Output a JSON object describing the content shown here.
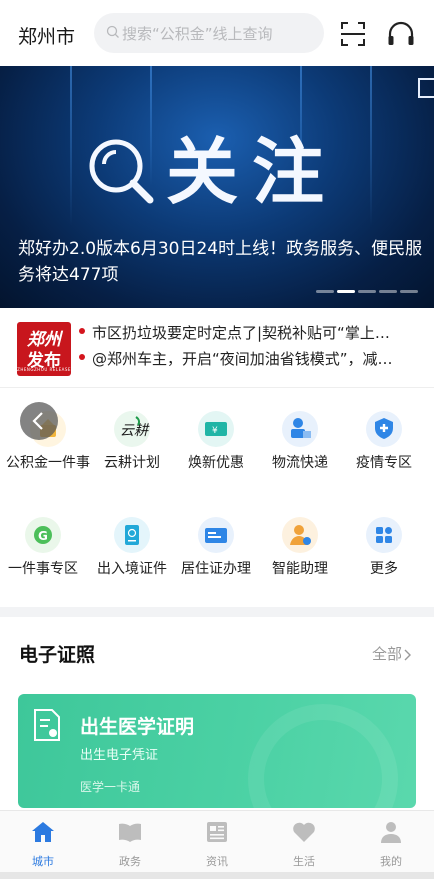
{
  "header": {
    "city": "郑州市",
    "search_placeholder": "搜索“公积金”线上查询"
  },
  "banner": {
    "headline": "关注",
    "caption": "郑好办2.0版本6月30日24时上线！政务服务、便民服务将达477项",
    "dots": 5,
    "active_dot": 1
  },
  "news": {
    "logo_line1": "郑州",
    "logo_line2": "发布",
    "logo_line3": "ZHENGZHOU RELEASE",
    "items": [
      "市区扔垃圾要定时定点了|契税补贴可“掌上…",
      "@郑州车主，开启“夜间加油省钱模式”，减…"
    ]
  },
  "services": [
    {
      "label": "公积金一件事",
      "icon": "housing-fund-icon",
      "color": "#f2b53a"
    },
    {
      "label": "云耕计划",
      "icon": "yungeng-icon",
      "color": "#1e9a4a"
    },
    {
      "label": "焕新优惠",
      "icon": "voucher-icon",
      "color": "#20b5a6"
    },
    {
      "label": "物流快递",
      "icon": "courier-icon",
      "color": "#2f86e6"
    },
    {
      "label": "疫情专区",
      "icon": "medical-shield-icon",
      "color": "#2f86e6"
    },
    {
      "label": "一件事专区",
      "icon": "one-thing-icon",
      "color": "#4cbf5a"
    },
    {
      "label": "出入境证件",
      "icon": "passport-icon",
      "color": "#22a8d8"
    },
    {
      "label": "居住证办理",
      "icon": "residence-card-icon",
      "color": "#2f86e6"
    },
    {
      "label": "智能助理",
      "icon": "assistant-icon",
      "color": "#f0a23a"
    },
    {
      "label": "更多",
      "icon": "more-grid-icon",
      "color": "#2f86e6"
    }
  ],
  "certificates": {
    "title": "电子证照",
    "all_label": "全部",
    "card": {
      "title": "出生医学证明",
      "subtitle": "出生电子凭证",
      "source": "医学一卡通",
      "color": "#45cd9f"
    }
  },
  "nav": {
    "items": [
      {
        "label": "城市",
        "icon": "home-icon",
        "active": true
      },
      {
        "label": "政务",
        "icon": "book-icon",
        "active": false
      },
      {
        "label": "资讯",
        "icon": "news-icon",
        "active": false
      },
      {
        "label": "生活",
        "icon": "heart-icon",
        "active": false
      },
      {
        "label": "我的",
        "icon": "person-icon",
        "active": false
      }
    ],
    "active_color": "#2c7ae0",
    "inactive_color": "#bdbdbd"
  }
}
